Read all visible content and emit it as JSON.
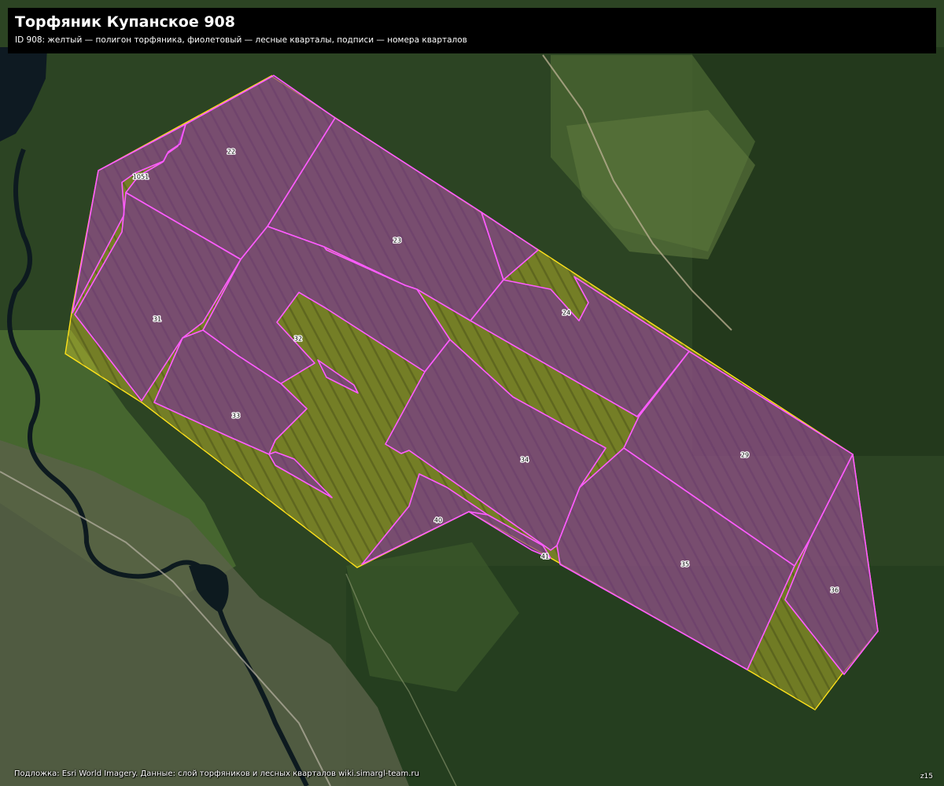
{
  "header": {
    "title": "Торфяник Купанское 908",
    "subtitle": "ID 908: желтый — полигон торфяника, фиолетовый — лесные кварталы, подписи — номера кварталов"
  },
  "footer": {
    "attribution": "Подложка: Esri World Imagery. Данные: слой торфяников и лесных кварталов wiki.simargl-team.ru",
    "zoom": "z15"
  },
  "colors": {
    "peat_outline": "#ffe21a",
    "peat_fill": "#d8cf2a",
    "quarter_outline": "#ff5cff",
    "quarter_fill": "#7a2f9c",
    "background_forest": "#2c4423",
    "header_bg": "#000000"
  },
  "map": {
    "peatland_id": "908",
    "quarter_labels": [
      "1051",
      "22",
      "23",
      "24",
      "29",
      "31",
      "32",
      "33",
      "34",
      "35",
      "36",
      "40",
      "41"
    ]
  }
}
